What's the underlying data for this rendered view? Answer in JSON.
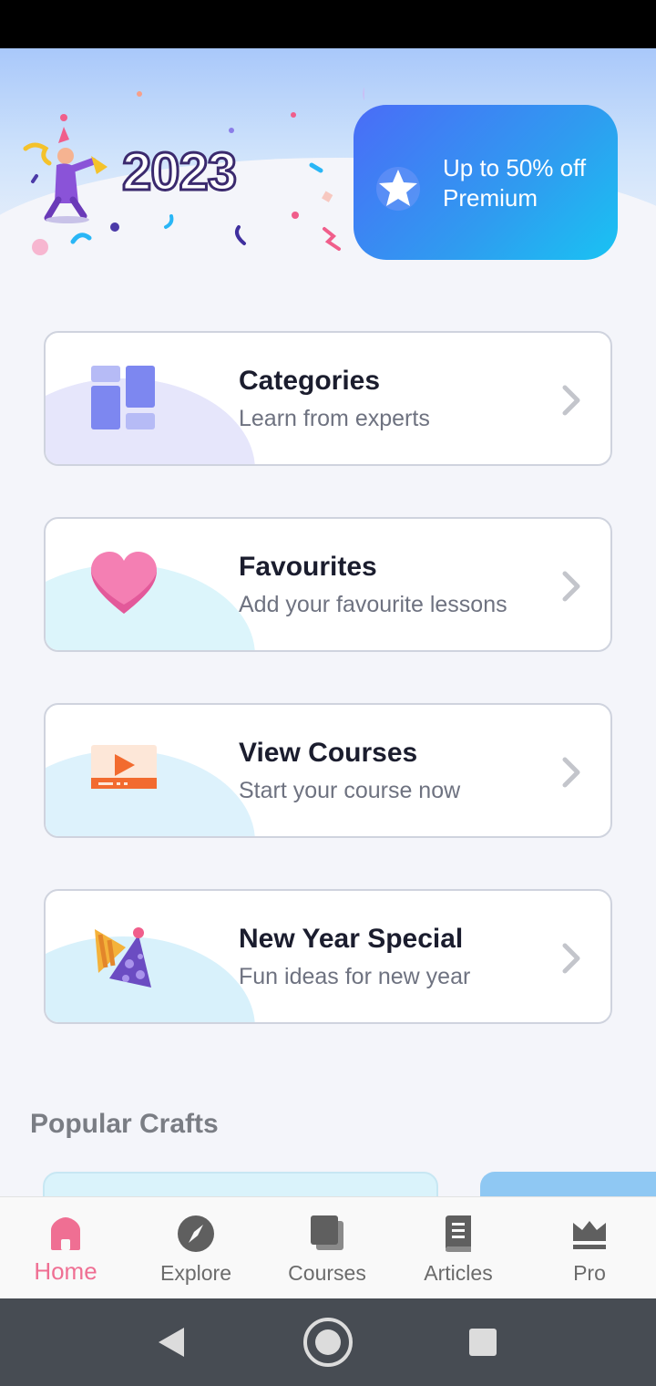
{
  "hero": {
    "year": "2023",
    "promo_line1": "Up to 50% off",
    "promo_line2": "Premium"
  },
  "menu": [
    {
      "title": "Categories",
      "subtitle": "Learn from experts",
      "icon": "grid-icon"
    },
    {
      "title": "Favourites",
      "subtitle": "Add your favourite lessons",
      "icon": "heart-icon"
    },
    {
      "title": "View Courses",
      "subtitle": "Start your course now",
      "icon": "video-icon"
    },
    {
      "title": "New Year Special",
      "subtitle": "Fun ideas for new year",
      "icon": "party-hat-icon"
    }
  ],
  "popular": {
    "title": "Popular Crafts"
  },
  "nav": [
    {
      "label": "Home",
      "icon": "home-icon",
      "active": true
    },
    {
      "label": "Explore",
      "icon": "compass-icon"
    },
    {
      "label": "Courses",
      "icon": "courses-icon"
    },
    {
      "label": "Articles",
      "icon": "book-icon"
    },
    {
      "label": "Pro",
      "icon": "crown-icon"
    }
  ],
  "colors": {
    "accent": "#ef6f93",
    "promo_start": "#4a6cf7",
    "promo_end": "#19c3f2",
    "title_text": "#1b1d2e",
    "subtitle_text": "#6e7280"
  }
}
